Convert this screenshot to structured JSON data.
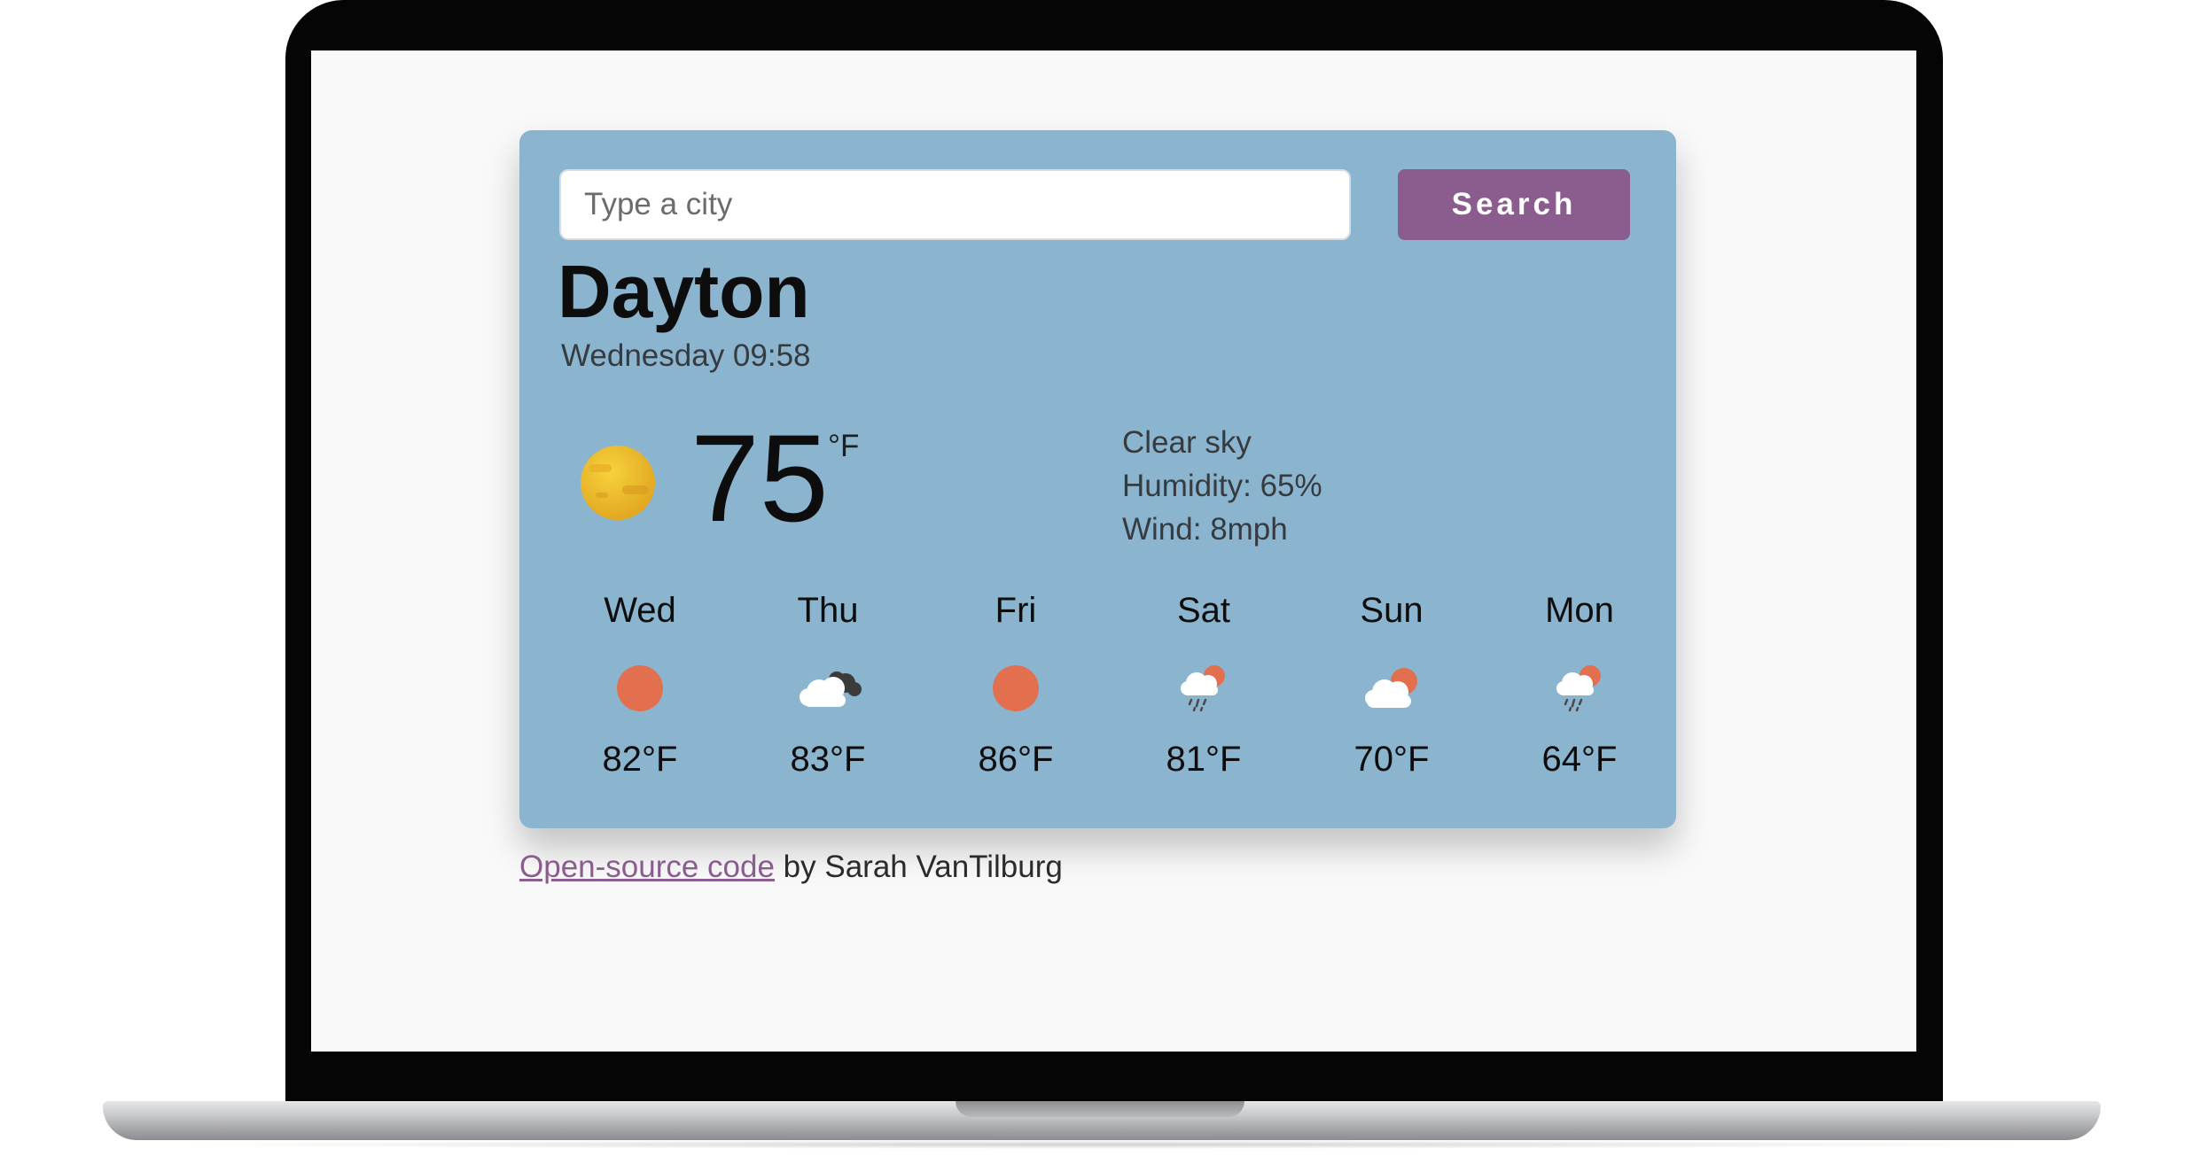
{
  "search": {
    "placeholder": "Type a city",
    "button_label": "Search"
  },
  "current": {
    "city": "Dayton",
    "date_time": "Wednesday 09:58",
    "temperature": "75",
    "unit": "°F",
    "icon": "sun-icon",
    "description": "Clear sky",
    "humidity": "Humidity: 65%",
    "wind": "Wind: 8mph"
  },
  "forecast": [
    {
      "day": "Wed",
      "temp": "82°F",
      "icon": "sun-icon"
    },
    {
      "day": "Thu",
      "temp": "83°F",
      "icon": "broken-clouds-icon"
    },
    {
      "day": "Fri",
      "temp": "86°F",
      "icon": "sun-icon"
    },
    {
      "day": "Sat",
      "temp": "81°F",
      "icon": "rain-sun-icon"
    },
    {
      "day": "Sun",
      "temp": "70°F",
      "icon": "partly-cloudy-icon"
    },
    {
      "day": "Mon",
      "temp": "64°F",
      "icon": "rain-sun-icon"
    }
  ],
  "footer": {
    "link_text": "Open-source code",
    "credit": " by Sarah VanTilburg"
  },
  "colors": {
    "card_background": "#8bb4cf",
    "accent": "#8a5d8e",
    "page_background": "#f9f9f9"
  }
}
